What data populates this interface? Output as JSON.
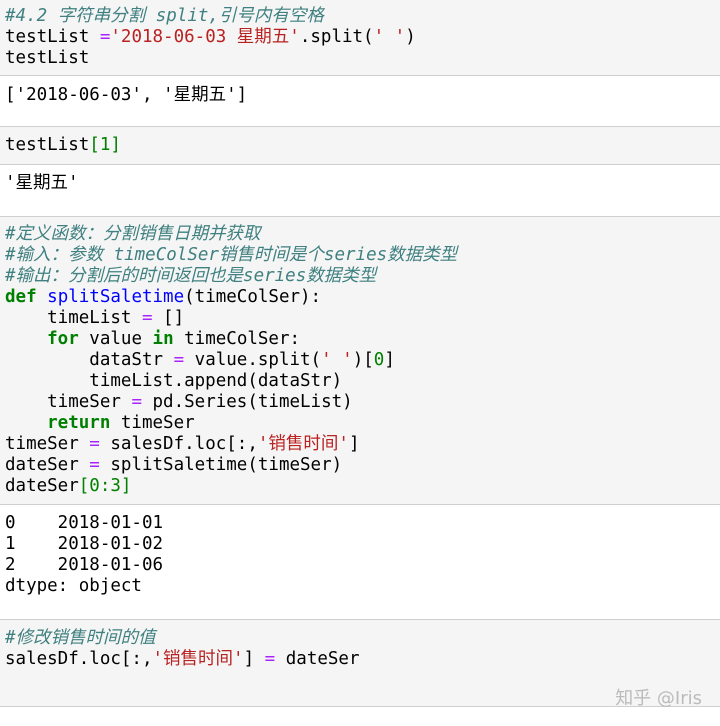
{
  "cells": [
    {
      "input": {
        "comment": "#4.2 字符串分割 split,引号内有空格",
        "line2": {
          "a": "testList ",
          "eq": "=",
          "str": "'2018-06-03 星期五'",
          "b": ".split(",
          "arg": "' '",
          "c": ")"
        },
        "line3": "testList"
      },
      "output": "['2018-06-03', '星期五']"
    },
    {
      "input": {
        "name": "testList",
        "idx": "[1]"
      },
      "output": "'星期五'"
    },
    {
      "input": {
        "comments": [
          "#定义函数：分割销售日期并获取",
          "#输入：参数 timeColSer销售时间是个series数据类型",
          "#输出：分割后的时间返回也是series数据类型"
        ],
        "def_kw": "def",
        "def_name": "splitSaletime",
        "def_args": "(timeColSer):",
        "l_timelist": "    timeList ",
        "l_timelist_eq": "=",
        "l_timelist_val": " []",
        "for_kw": "    for",
        "for_a": " value ",
        "in_kw": "in",
        "for_b": " timeColSer:",
        "datastr_a": "        dataStr ",
        "datastr_eq": "=",
        "datastr_b": " value.split(",
        "datastr_str": "' '",
        "datastr_c": ")[",
        "datastr_num": "0",
        "datastr_d": "]",
        "append": "        timeList.append(dataStr)",
        "timeser_a": "    timeSer ",
        "timeser_eq": "=",
        "timeser_b": " pd.Series(timeList)",
        "return_kw": "    return",
        "return_b": " timeSer",
        "ts_a": "timeSer ",
        "ts_eq": "=",
        "ts_b": " salesDf.loc[:,",
        "ts_str": "'销售时间'",
        "ts_c": "]",
        "ds_a": "dateSer ",
        "ds_eq": "=",
        "ds_b": " splitSaletime(timeSer)",
        "last_a": "dateSer",
        "last_b": "[0:3]"
      },
      "output_lines": [
        "0    2018-01-01",
        "1    2018-01-02",
        "2    2018-01-06",
        "dtype: object"
      ]
    },
    {
      "input": {
        "comment": "#修改销售时间的值",
        "a": "salesDf.loc[:,",
        "str": "'销售时间'",
        "b": "] ",
        "eq": "=",
        "c": " dateSer"
      }
    }
  ],
  "watermark": "知乎 @Iris"
}
